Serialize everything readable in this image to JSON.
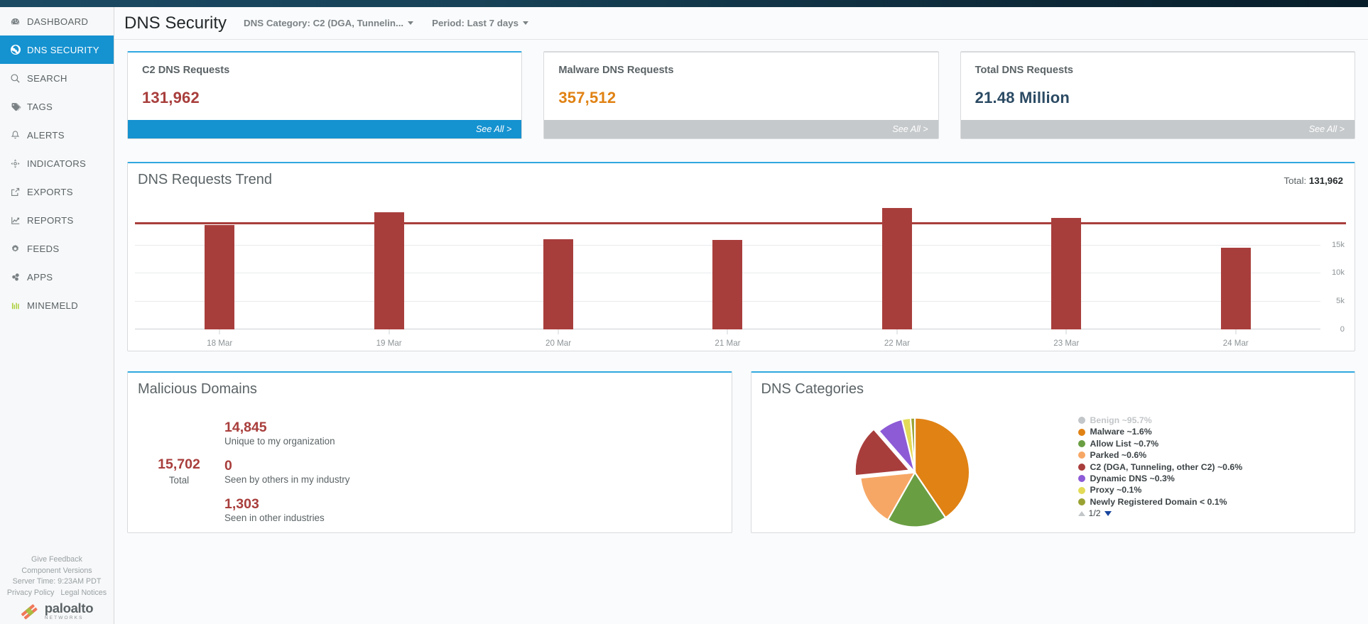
{
  "sidebar": {
    "items": [
      {
        "label": "DASHBOARD",
        "icon": "dashboard-icon",
        "active": false
      },
      {
        "label": "DNS SECURITY",
        "icon": "globe-icon",
        "active": true
      },
      {
        "label": "SEARCH",
        "icon": "search-icon",
        "active": false
      },
      {
        "label": "TAGS",
        "icon": "tag-icon",
        "active": false
      },
      {
        "label": "ALERTS",
        "icon": "bell-icon",
        "active": false
      },
      {
        "label": "INDICATORS",
        "icon": "indicator-icon",
        "active": false
      },
      {
        "label": "EXPORTS",
        "icon": "external-link-icon",
        "active": false
      },
      {
        "label": "REPORTS",
        "icon": "chart-line-icon",
        "active": false
      },
      {
        "label": "FEEDS",
        "icon": "gear-icon",
        "active": false
      },
      {
        "label": "APPS",
        "icon": "apps-icon",
        "active": false
      },
      {
        "label": "MINEMELD",
        "icon": "minemeld-icon",
        "active": false
      }
    ],
    "footer": {
      "give_feedback": "Give Feedback",
      "component_versions": "Component Versions",
      "server_time": "Server Time: 9:23AM PDT",
      "privacy_policy": "Privacy Policy",
      "legal_notices": "Legal Notices",
      "logo_main": "paloalto",
      "logo_sub": "NETWORKS"
    }
  },
  "header": {
    "title": "DNS Security",
    "category_filter": "DNS Category: C2 (DGA, Tunnelin...",
    "period_filter": "Period: Last 7 days"
  },
  "kpi_cards": [
    {
      "title": "C2 DNS Requests",
      "value": "131,962",
      "color": "#a83e3c",
      "footer_label": "See All >",
      "footer_style": "blue",
      "accent": "#2fa8e0"
    },
    {
      "title": "Malware DNS Requests",
      "value": "357,512",
      "color": "#e08214",
      "footer_label": "See All >",
      "footer_style": "gray",
      "accent": "#d7dadc"
    },
    {
      "title": "Total DNS Requests",
      "value": "21.48 Million",
      "color": "#2b4a63",
      "footer_label": "See All >",
      "footer_style": "gray",
      "accent": "#d7dadc"
    }
  ],
  "trend_panel": {
    "title": "DNS Requests Trend",
    "total_label": "Total:",
    "total_value": "131,962"
  },
  "malicious_domains": {
    "title": "Malicious Domains",
    "total_value": "15,702",
    "total_label": "Total",
    "items": [
      {
        "value": "14,845",
        "label": "Unique to my organization"
      },
      {
        "value": "0",
        "label": "Seen by others in my industry"
      },
      {
        "value": "1,303",
        "label": "Seen in other industries"
      }
    ]
  },
  "dns_categories": {
    "title": "DNS Categories",
    "pager": "1/2"
  },
  "chart_data": [
    {
      "type": "bar",
      "title": "DNS Requests Trend",
      "categories": [
        "18 Mar",
        "19 Mar",
        "20 Mar",
        "21 Mar",
        "22 Mar",
        "23 Mar",
        "24 Mar"
      ],
      "values": [
        18500,
        20700,
        16000,
        15800,
        21500,
        19800,
        14500
      ],
      "xlabel": "",
      "ylabel": "",
      "ylim": [
        0,
        22000
      ],
      "yticks": [
        0,
        5000,
        10000,
        15000
      ],
      "ytick_labels": [
        "0",
        "5k",
        "10k",
        "15k"
      ],
      "grid": true,
      "bar_color": "#a83e3c",
      "threshold_line": {
        "value": 18600,
        "color": "#a83e3c"
      },
      "legend": "none"
    },
    {
      "type": "pie",
      "title": "DNS Categories",
      "categories": [
        "Benign",
        "Malware",
        "Allow List",
        "Parked",
        "C2 (DGA, Tunneling, other C2)",
        "Dynamic DNS",
        "Proxy",
        "Newly Registered Domain"
      ],
      "values": [
        95.7,
        1.6,
        0.7,
        0.6,
        0.6,
        0.3,
        0.1,
        0.05
      ],
      "labels": [
        "Benign ~95.7%",
        "Malware ~1.6%",
        "Allow List ~0.7%",
        "Parked ~0.6%",
        "C2 (DGA, Tunneling, other C2) ~0.6%",
        "Dynamic DNS ~0.3%",
        "Proxy ~0.1%",
        "Newly Registered Domain < 0.1%"
      ],
      "colors": [
        "#bdc3c7",
        "#e08214",
        "#6a9e43",
        "#f7a765",
        "#a83e3c",
        "#8d5bd6",
        "#e3db57",
        "#9aa233"
      ],
      "hidden_slices": [
        "Benign"
      ],
      "exploded_slices": [
        "C2 (DGA, Tunneling, other C2)"
      ],
      "legend_position": "right",
      "legend_page": "1/2"
    }
  ]
}
